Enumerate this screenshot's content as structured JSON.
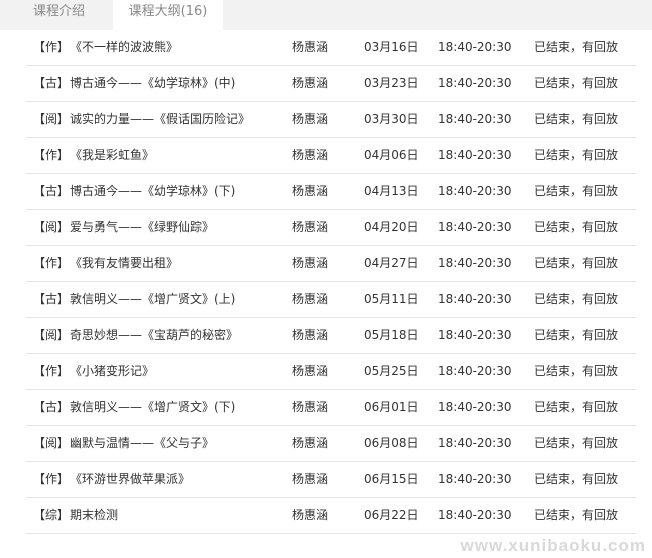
{
  "tabs": [
    {
      "label": "课程介绍"
    },
    {
      "label": "课程大纲(16)"
    }
  ],
  "lessons": [
    {
      "tag": "【作】",
      "title": "《不一样的波波熊》",
      "teacher": "杨惠涵",
      "date": "03月16日",
      "time": "18:40-20:30",
      "status": "已结束，有回放"
    },
    {
      "tag": "【古】",
      "title": "博古通今——《幼学琼林》(中)",
      "teacher": "杨惠涵",
      "date": "03月23日",
      "time": "18:40-20:30",
      "status": "已结束，有回放"
    },
    {
      "tag": "【阅】",
      "title": "诚实的力量——《假话国历险记》",
      "teacher": "杨惠涵",
      "date": "03月30日",
      "time": "18:40-20:30",
      "status": "已结束，有回放"
    },
    {
      "tag": "【作】",
      "title": "《我是彩虹鱼》",
      "teacher": "杨惠涵",
      "date": "04月06日",
      "time": "18:40-20:30",
      "status": "已结束，有回放"
    },
    {
      "tag": "【古】",
      "title": "博古通今——《幼学琼林》(下)",
      "teacher": "杨惠涵",
      "date": "04月13日",
      "time": "18:40-20:30",
      "status": "已结束，有回放"
    },
    {
      "tag": "【阅】",
      "title": "爱与勇气——《绿野仙踪》",
      "teacher": "杨惠涵",
      "date": "04月20日",
      "time": "18:40-20:30",
      "status": "已结束，有回放"
    },
    {
      "tag": "【作】",
      "title": "《我有友情要出租》",
      "teacher": "杨惠涵",
      "date": "04月27日",
      "time": "18:40-20:30",
      "status": "已结束，有回放"
    },
    {
      "tag": "【古】",
      "title": "敦信明义——《增广贤文》(上)",
      "teacher": "杨惠涵",
      "date": "05月11日",
      "time": "18:40-20:30",
      "status": "已结束，有回放"
    },
    {
      "tag": "【阅】",
      "title": "奇思妙想——《宝葫芦的秘密》",
      "teacher": "杨惠涵",
      "date": "05月18日",
      "time": "18:40-20:30",
      "status": "已结束，有回放"
    },
    {
      "tag": "【作】",
      "title": "《小猪变形记》",
      "teacher": "杨惠涵",
      "date": "05月25日",
      "time": "18:40-20:30",
      "status": "已结束，有回放"
    },
    {
      "tag": "【古】",
      "title": "敦信明义——《增广贤文》(下)",
      "teacher": "杨惠涵",
      "date": "06月01日",
      "time": "18:40-20:30",
      "status": "已结束，有回放"
    },
    {
      "tag": "【阅】",
      "title": "幽默与温情——《父与子》",
      "teacher": "杨惠涵",
      "date": "06月08日",
      "time": "18:40-20:30",
      "status": "已结束，有回放"
    },
    {
      "tag": "【作】",
      "title": "《环游世界做苹果派》",
      "teacher": "杨惠涵",
      "date": "06月15日",
      "time": "18:40-20:30",
      "status": "已结束，有回放"
    },
    {
      "tag": "【综】",
      "title": "期末检测",
      "teacher": "杨惠涵",
      "date": "06月22日",
      "time": "18:40-20:30",
      "status": "已结束，有回放"
    }
  ],
  "watermark": "www.xunibaoku.com"
}
